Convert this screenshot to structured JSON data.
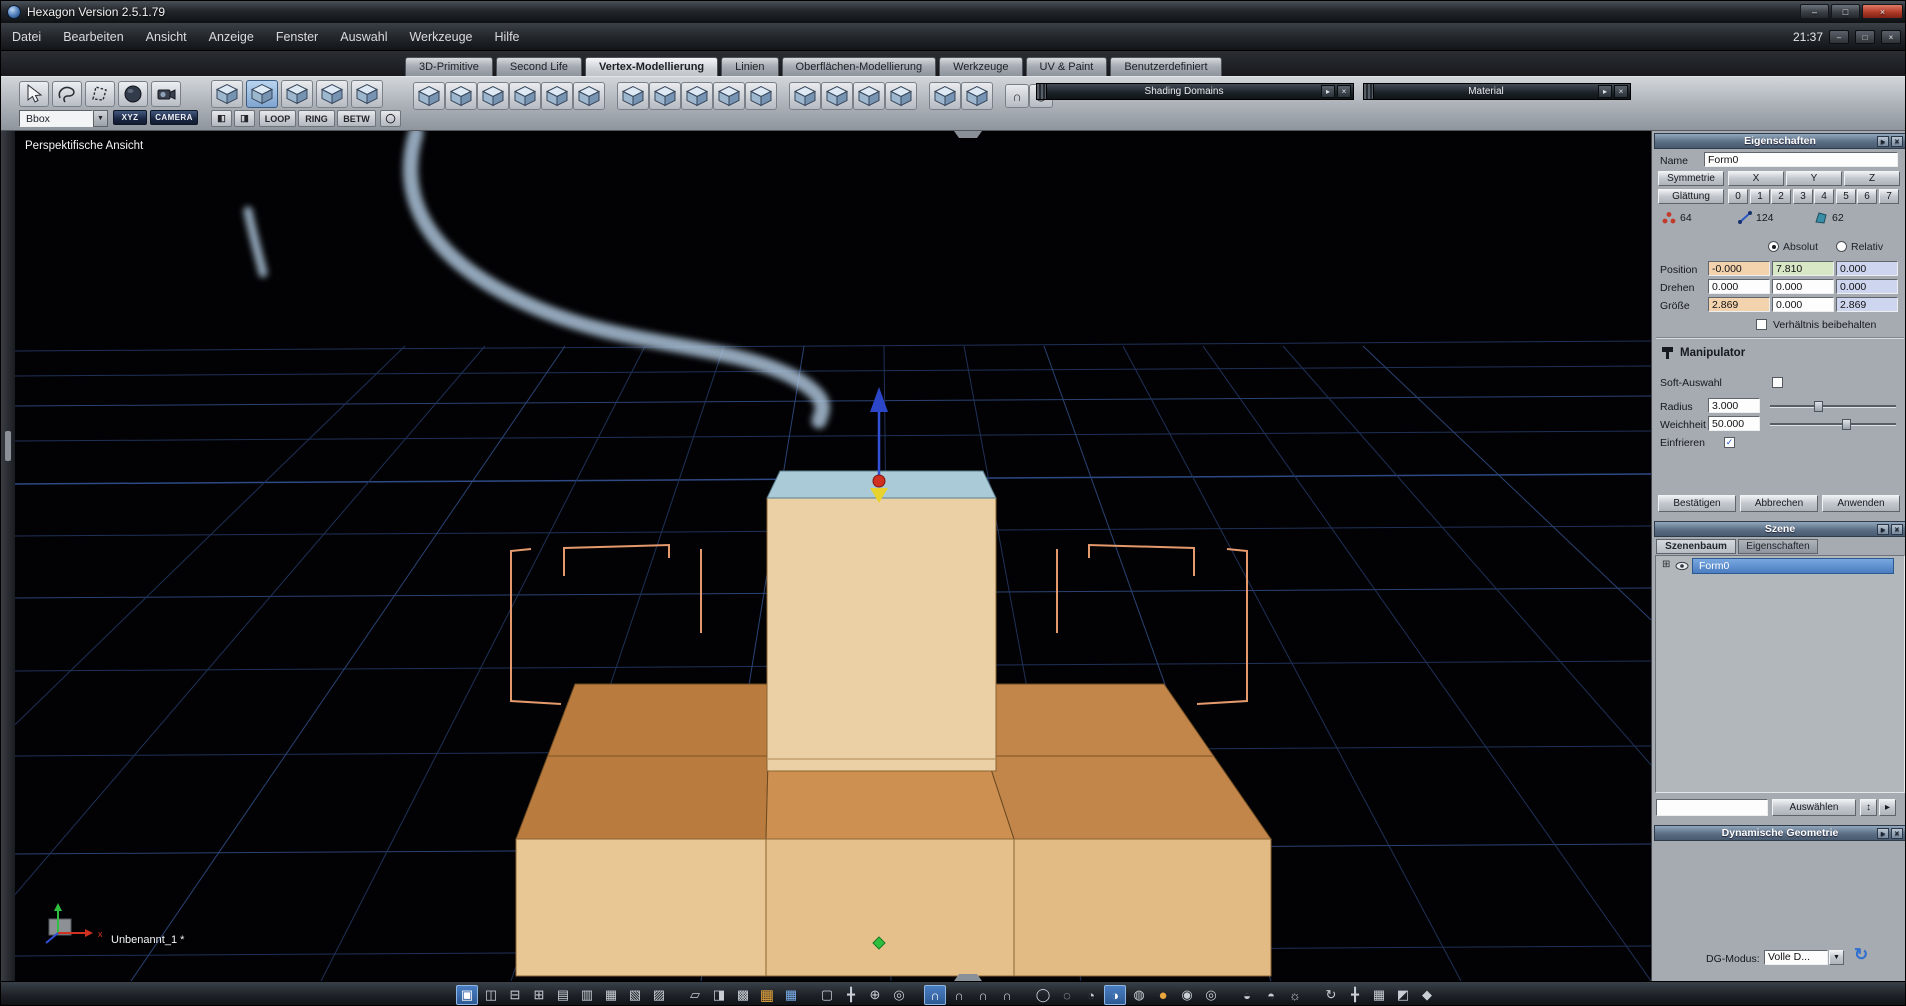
{
  "window": {
    "title": "Hexagon Version 2.5.1.79",
    "clock": "21:37"
  },
  "menu": {
    "items": [
      "Datei",
      "Bearbeiten",
      "Ansicht",
      "Anzeige",
      "Fenster",
      "Auswahl",
      "Werkzeuge",
      "Hilfe"
    ]
  },
  "tabs": [
    {
      "label": "3D-Primitive"
    },
    {
      "label": "Second Life"
    },
    {
      "label": "Vertex-Modellierung"
    },
    {
      "label": "Linien"
    },
    {
      "label": "Oberflächen-Modellierung"
    },
    {
      "label": "Werkzeuge"
    },
    {
      "label": "UV & Paint"
    },
    {
      "label": "Benutzerdefiniert"
    }
  ],
  "toolbar": {
    "selector_value": "Bbox",
    "xyz": "XYZ",
    "camera": "CAMERA",
    "loop": "LOOP",
    "ring": "RING",
    "betw": "BETW",
    "shading_domains": "Shading Domains",
    "material": "Material"
  },
  "viewport": {
    "label": "Perspektifische Ansicht",
    "document": "Unbenannt_1 *",
    "axis_x": "x"
  },
  "properties": {
    "title": "Eigenschaften",
    "name_label": "Name",
    "name_value": "Form0",
    "symmetry_label": "Symmetrie",
    "axis_buttons": [
      "X",
      "Y",
      "Z"
    ],
    "smoothing_label": "Glättung",
    "smoothing_levels": [
      "0",
      "1",
      "2",
      "3",
      "4",
      "5",
      "6",
      "7"
    ],
    "counts": {
      "vertices": "64",
      "edges": "124",
      "faces": "62"
    },
    "absolute_label": "Absolut",
    "relative_label": "Relativ",
    "position_label": "Position",
    "rotation_label": "Drehen",
    "size_label": "Größe",
    "position": [
      "-0.000",
      "7.810",
      "0.000"
    ],
    "rotation": [
      "0.000",
      "0.000",
      "0.000"
    ],
    "size": [
      "2.869",
      "0.000",
      "2.869"
    ],
    "keep_ratio_label": "Verhältnis beibehalten",
    "manipulator_label": "Manipulator",
    "soft_selection_label": "Soft-Auswahl",
    "radius_label": "Radius",
    "radius_value": "3.000",
    "softness_label": "Weichheit",
    "softness_value": "50.000",
    "freeze_label": "Einfrieren",
    "confirm_label": "Bestätigen",
    "cancel_label": "Abbrechen",
    "apply_label": "Anwenden"
  },
  "scene": {
    "title": "Szene",
    "tab_tree": "Szenenbaum",
    "tab_props": "Eigenschaften",
    "tree_item": "Form0",
    "select_button": "Auswählen"
  },
  "dynamic_geometry": {
    "title": "Dynamische Geometrie",
    "mode_label": "DG-Modus:",
    "mode_value": "Volle D..."
  },
  "icons": {
    "window_controls": [
      "–",
      "□",
      "×"
    ],
    "app_window_controls": [
      "–",
      "□",
      "×"
    ],
    "panel_collapse": "▸",
    "panel_close": "×",
    "dropdown_arrow": "▼",
    "paint_tools": [
      "◧",
      "◨"
    ],
    "select_circle": "◯",
    "strip_extra": [
      "∩",
      "◍"
    ],
    "scene_footer": [
      "↕",
      "▸"
    ],
    "dg_sync": "↻",
    "check": "✓",
    "tree_expander": "⊞",
    "bottom": [
      "▣",
      "◫",
      "⊟",
      "⊞",
      "▤",
      "▥",
      "▦",
      "▧",
      "▨",
      "▱",
      "◨",
      "▩",
      "▦",
      "▦",
      "▢",
      "╋",
      "⊕",
      "◎",
      "∩",
      "∩",
      "∩",
      "∩",
      "◯",
      "◌",
      "◔",
      "◑",
      "◍",
      "●",
      "◉",
      "◎",
      "◒",
      "◓",
      "☼",
      "↻",
      "╋",
      "▦",
      "◩",
      "◆"
    ]
  }
}
